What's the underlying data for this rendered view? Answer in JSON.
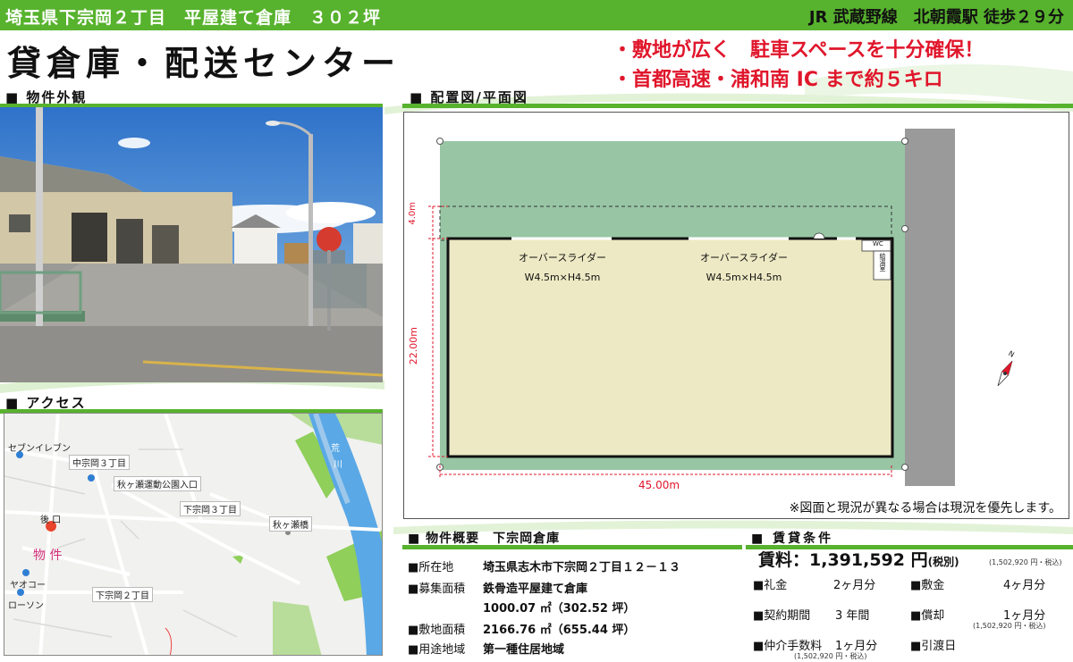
{
  "header": {
    "address": "埼玉県下宗岡２丁目　平屋建て倉庫　３０２坪",
    "station": "JR 武蔵野線　北朝霞駅 徒歩２９分"
  },
  "title": "貸倉庫・配送センター",
  "features": [
    "・敷地が広く　駐車スペースを十分確保！",
    "・首都高速・浦和南 IC まで約５キロ"
  ],
  "sections": {
    "exterior": "物件外観",
    "layout": "配置図/平面図",
    "access": "アクセス",
    "summary": "物件概要　下宗岡倉庫",
    "terms": "賃貸条件"
  },
  "map": {
    "labels": [
      "セブンイレブン",
      "中宗岡３丁目",
      "秋ヶ瀬運動公園入口",
      "下宗岡３丁目",
      "秋ヶ瀬橋",
      "後 口",
      "物 件",
      "ヤオコー",
      "ローソン",
      "下宗岡２丁目",
      "荒",
      "川"
    ]
  },
  "plan": {
    "door1": "オーバースライダー",
    "door1_size": "W4.5m×H4.5m",
    "door2": "オーバースライダー",
    "door2_size": "W4.5m×H4.5m",
    "wc": "WC",
    "kyutoshitsu": "給湯室",
    "dim_width": "45.00m",
    "dim_height": "22.00m",
    "dim_yard": "4.0m",
    "compass": "N",
    "note": "※図面と現況が異なる場合は現況を優先します。"
  },
  "summary": {
    "rows": [
      {
        "k": "■所在地",
        "v": "埼玉県志木市下宗岡２丁目１２－１３"
      },
      {
        "k": "■募集面積",
        "v": "鉄骨造平屋建て倉庫"
      },
      {
        "k": "",
        "v": "1000.07 ㎡（302.52 坪）"
      },
      {
        "k": "■敷地面積",
        "v": "2166.76 ㎡（655.44 坪）"
      },
      {
        "k": "■用途地域",
        "v": "第一種住居地域"
      }
    ]
  },
  "terms": {
    "rent_label": "賃料：",
    "rent_value": "1,391,592 円",
    "rent_tax": "(税別)",
    "rent_incl": "(1,502,920 円・税込)",
    "reikin_k": "■礼金",
    "reikin_v": "2ヶ月分",
    "shikikin_k": "■敷金",
    "shikikin_v": "4ヶ月分",
    "kikan_k": "■契約期間",
    "kikan_v": "3 年間",
    "shokyaku_k": "■償却",
    "shokyaku_v": "1ヶ月分",
    "shokyaku_incl": "(1,502,920 円・税込)",
    "chukai_k": "■仲介手数料",
    "chukai_v": "1ヶ月分",
    "chukai_incl": "(1,502,920 円・税込)",
    "hikiwatashi_k": "■引渡日",
    "hikiwatashi_v": ""
  },
  "colors": {
    "brand_green": "#57b22d",
    "accent_red": "#e0162b",
    "plan_yard": "#98c6a5",
    "plan_floor": "#ede9c4"
  }
}
